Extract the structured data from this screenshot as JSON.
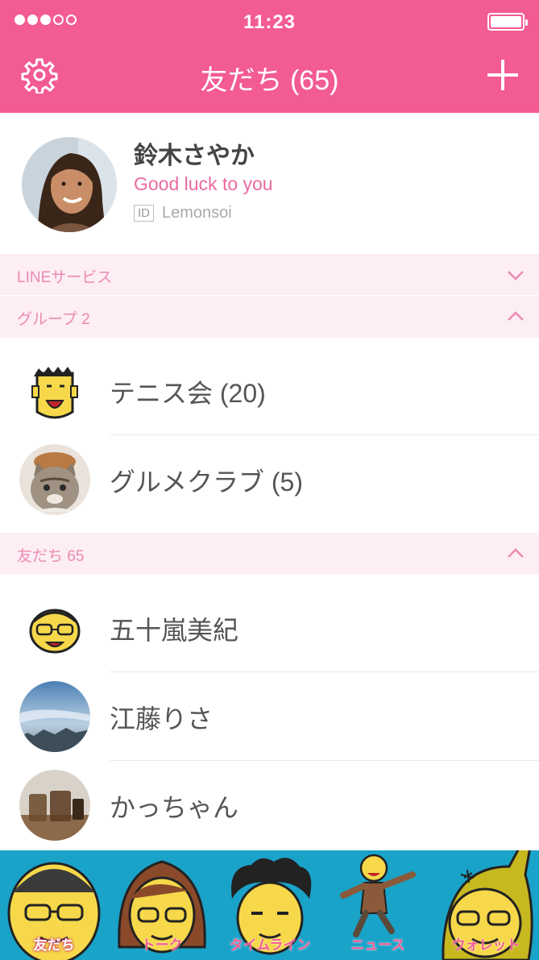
{
  "status_bar": {
    "time": "11:23",
    "signal_dots_filled": 3,
    "signal_dots_total": 5
  },
  "header": {
    "title": "友だち (65)",
    "settings_icon": "gear-icon",
    "add_icon": "plus-icon"
  },
  "colors": {
    "brand_pink": "#f35b93",
    "section_bg": "#fdeef4",
    "section_text": "#ec8ab2",
    "tabbar_bg": "#1aa3c9"
  },
  "profile": {
    "name": "鈴木さやか",
    "status_message": "Good luck to you",
    "id_badge": "ID",
    "id_value": "Lemonsoi"
  },
  "sections": {
    "line_services": {
      "label": "LINEサービス",
      "state": "collapsed"
    },
    "groups": {
      "label": "グループ 2",
      "state": "expanded"
    },
    "friends": {
      "label": "友だち 65",
      "state": "expanded"
    }
  },
  "groups": [
    {
      "name": "テニス会 (20)"
    },
    {
      "name": "グルメクラブ (5)"
    }
  ],
  "friends": [
    {
      "name": "五十嵐美紀"
    },
    {
      "name": "江藤りさ"
    },
    {
      "name": "かっちゃん"
    }
  ],
  "tabs": [
    {
      "label": "友だち",
      "active": true
    },
    {
      "label": "トーク",
      "active": false
    },
    {
      "label": "タイムライン",
      "active": false
    },
    {
      "label": "ニュース",
      "active": false
    },
    {
      "label": "ウォレット",
      "active": false
    }
  ]
}
